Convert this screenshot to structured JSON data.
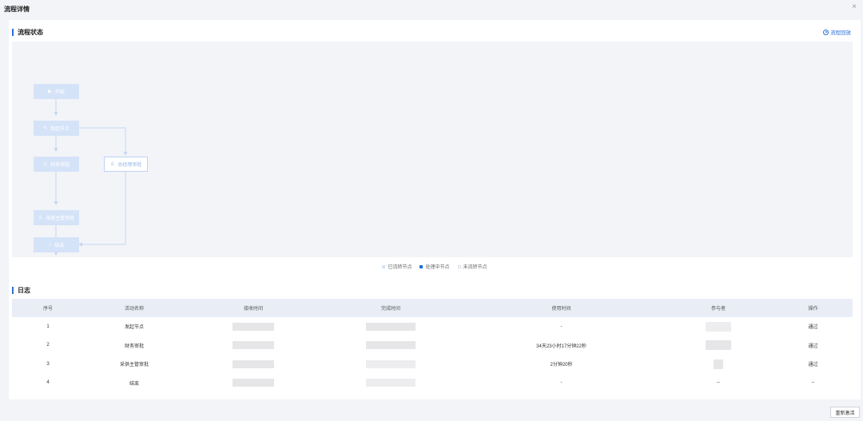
{
  "dialog": {
    "title": "流程详情",
    "close_icon": "×"
  },
  "flow": {
    "section_title": "流程状态",
    "replay_label": "流程回放",
    "nodes": {
      "start": "开始",
      "initiate": "发起节点",
      "finance": "财务审批",
      "gm": "总经理审批",
      "supplier": "采供主管审批",
      "end": "结束"
    },
    "legend": {
      "done": "已流转节点",
      "processing": "处理中节点",
      "pending": "未流转节点"
    },
    "colors": {
      "done": "#d5e3f8",
      "processing": "#1f6fd4",
      "pending_border": "#bcd3f5",
      "accent": "#2f6fd6"
    }
  },
  "log": {
    "section_title": "日志",
    "headers": [
      "序号",
      "活动名称",
      "接收时间",
      "完成时间",
      "使用时间",
      "参与者",
      "操作"
    ],
    "rows": [
      {
        "no": "1",
        "name": "发起节点",
        "duration": "-",
        "participant": "",
        "action": "通过"
      },
      {
        "no": "2",
        "name": "财务审批",
        "duration": "34天23小时17分钟22秒",
        "participant": "",
        "action": "通过"
      },
      {
        "no": "3",
        "name": "采供主管审批",
        "duration": "2分钟20秒",
        "participant": "",
        "action": "通过"
      },
      {
        "no": "4",
        "name": "结束",
        "duration": "-",
        "participant": "--",
        "action": "--"
      }
    ]
  },
  "footer": {
    "redo_label": "重新激活"
  }
}
